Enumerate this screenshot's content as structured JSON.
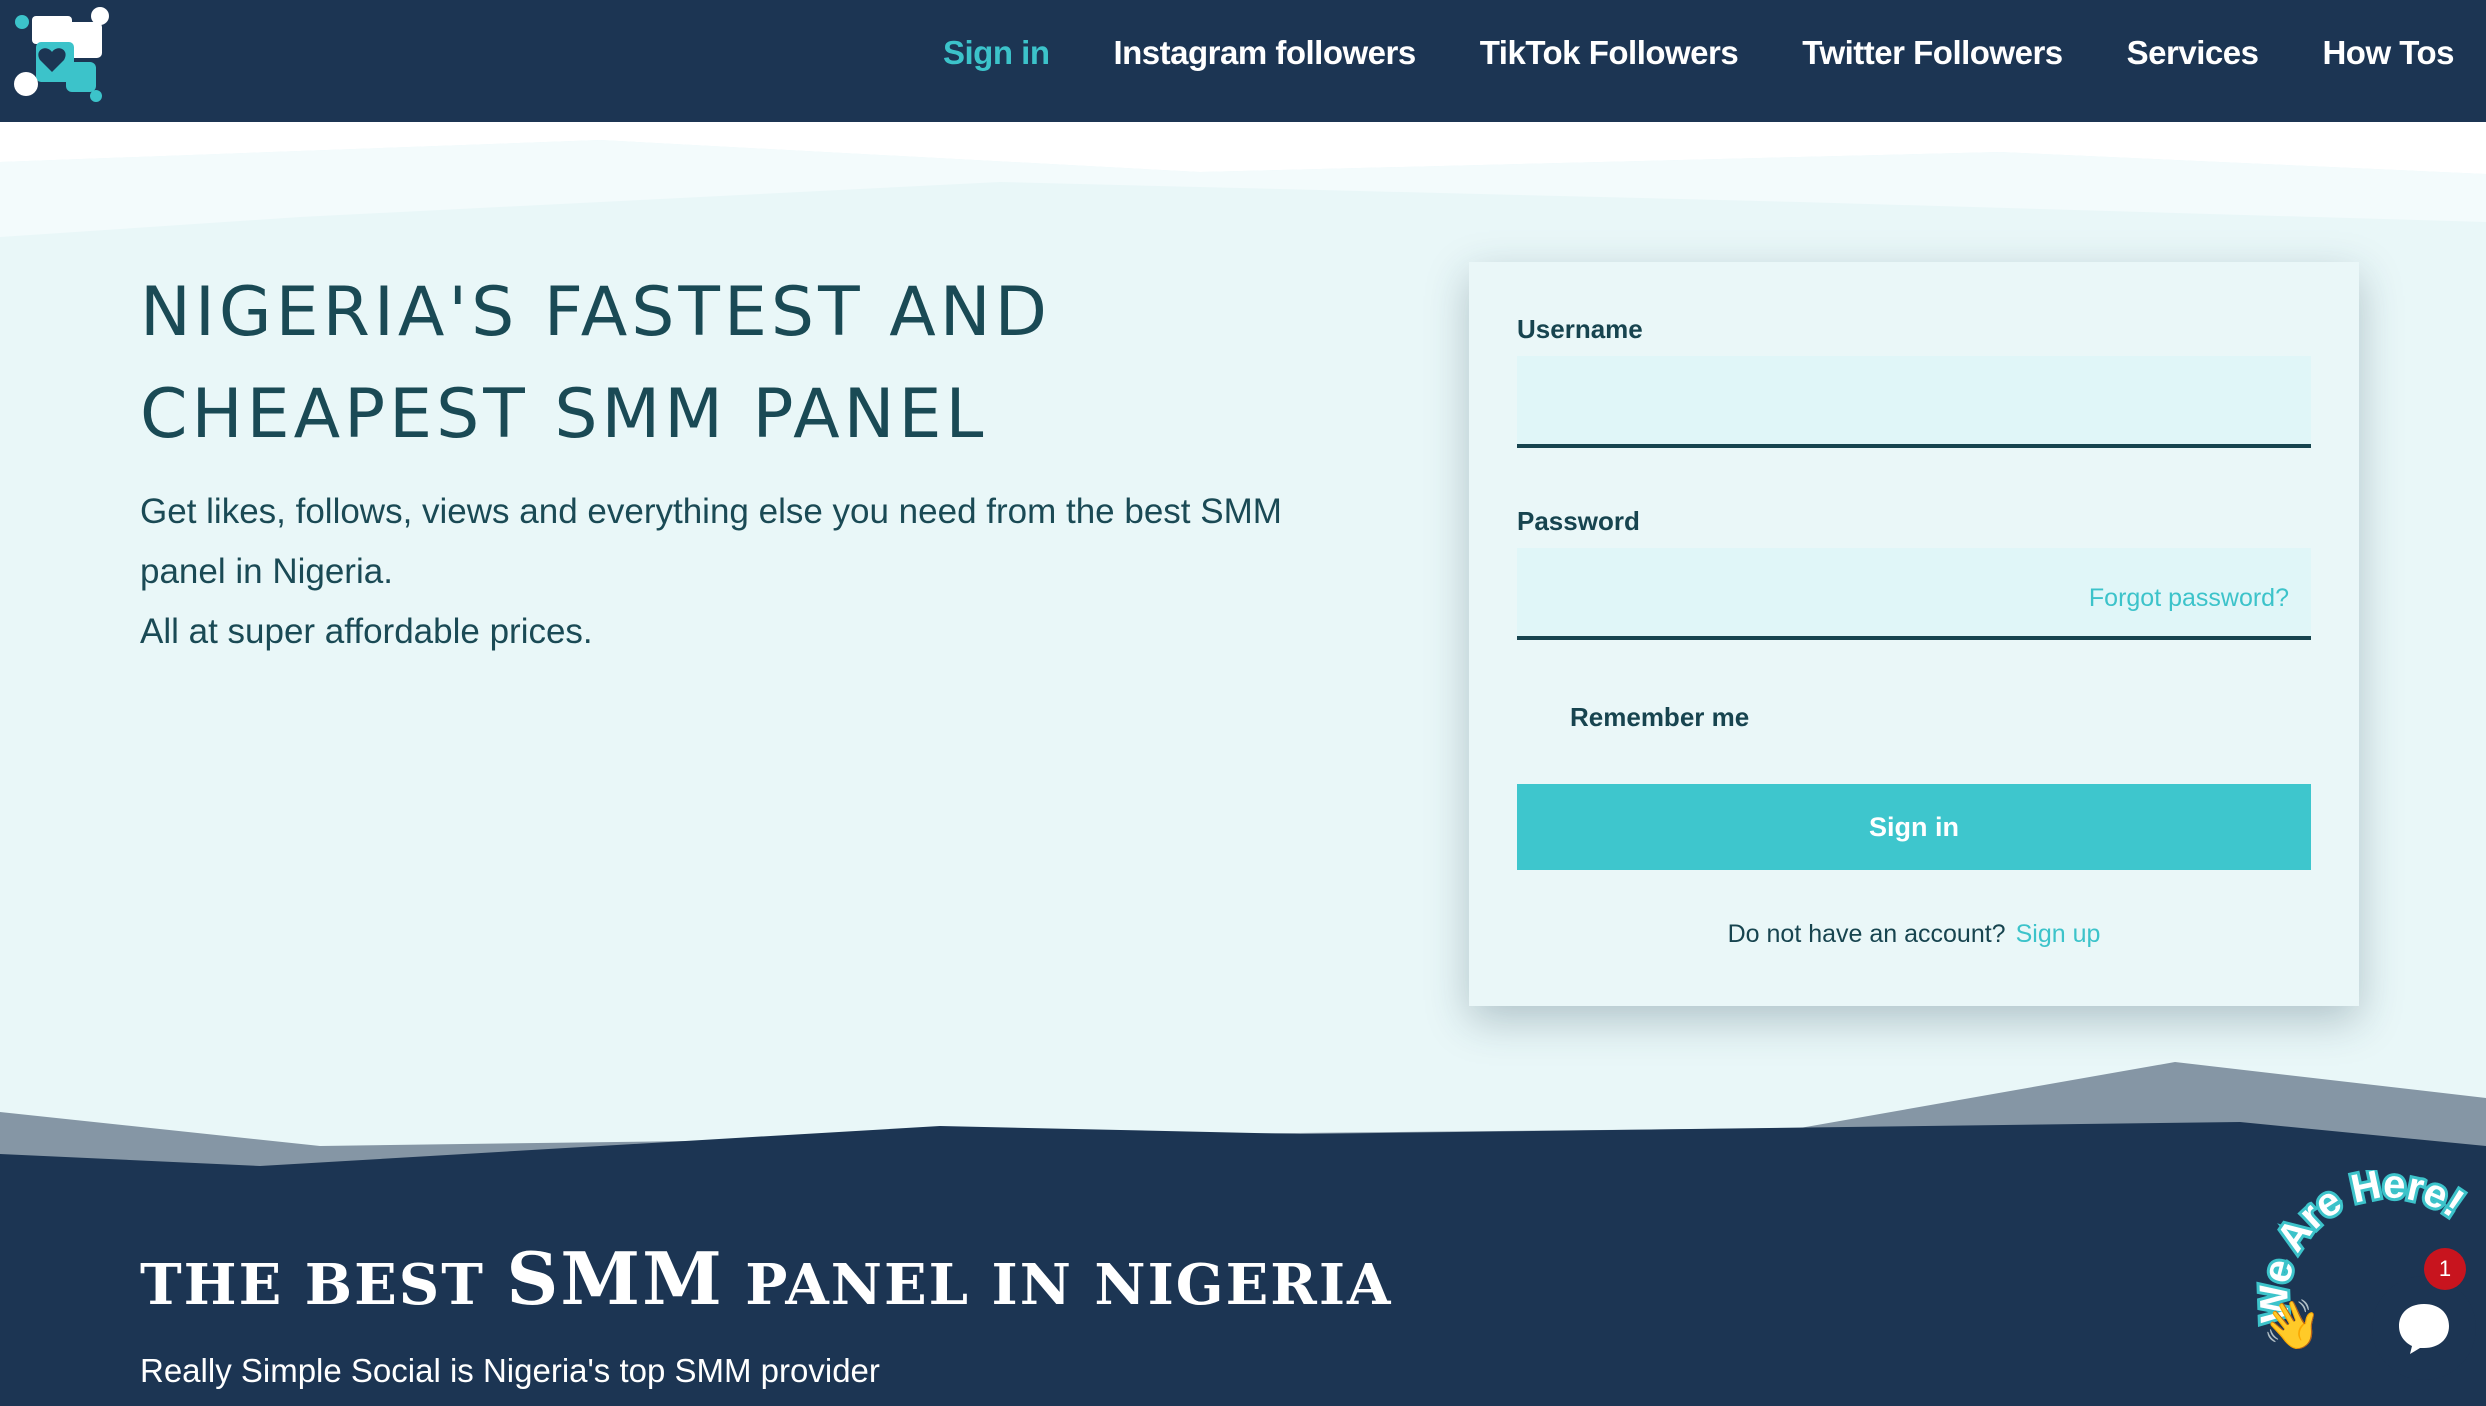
{
  "nav": {
    "items": [
      {
        "label": "Sign in",
        "active": true
      },
      {
        "label": "Instagram followers",
        "active": false
      },
      {
        "label": "TikTok Followers",
        "active": false
      },
      {
        "label": "Twitter Followers",
        "active": false
      },
      {
        "label": "Services",
        "active": false
      },
      {
        "label": "How Tos",
        "active": false
      }
    ]
  },
  "hero": {
    "title_line1": "NIGERIA'S FASTEST AND",
    "title_line2": "CHEAPEST SMM PANEL",
    "subtitle_line1": "Get likes, follows, views and everything else you need from the best SMM panel in Nigeria.",
    "subtitle_line2": "All at super affordable prices."
  },
  "login": {
    "username_label": "Username",
    "username_value": "",
    "password_label": "Password",
    "password_value": "",
    "forgot_label": "Forgot password?",
    "remember_label": "Remember me",
    "remember_checked": false,
    "signin_label": "Sign in",
    "signup_prompt": "Do not have an account?",
    "signup_link": "Sign up"
  },
  "section": {
    "title_part1": "THE BEST ",
    "title_part2": "SMM",
    "title_part3": " PANEL IN NIGERIA",
    "subtitle": "Really Simple Social is Nigeria's top SMM provider"
  },
  "chat": {
    "tagline": "We Are Here!",
    "badge_count": "1",
    "wave_icon": "waving-hand-icon",
    "chat_icon": "chat-bubble-icon"
  },
  "colors": {
    "nav_bg": "#1c3553",
    "accent": "#3ec6cd",
    "hero_bg": "#e9f7f8",
    "text_dark": "#17444f",
    "badge": "#c8141e"
  }
}
